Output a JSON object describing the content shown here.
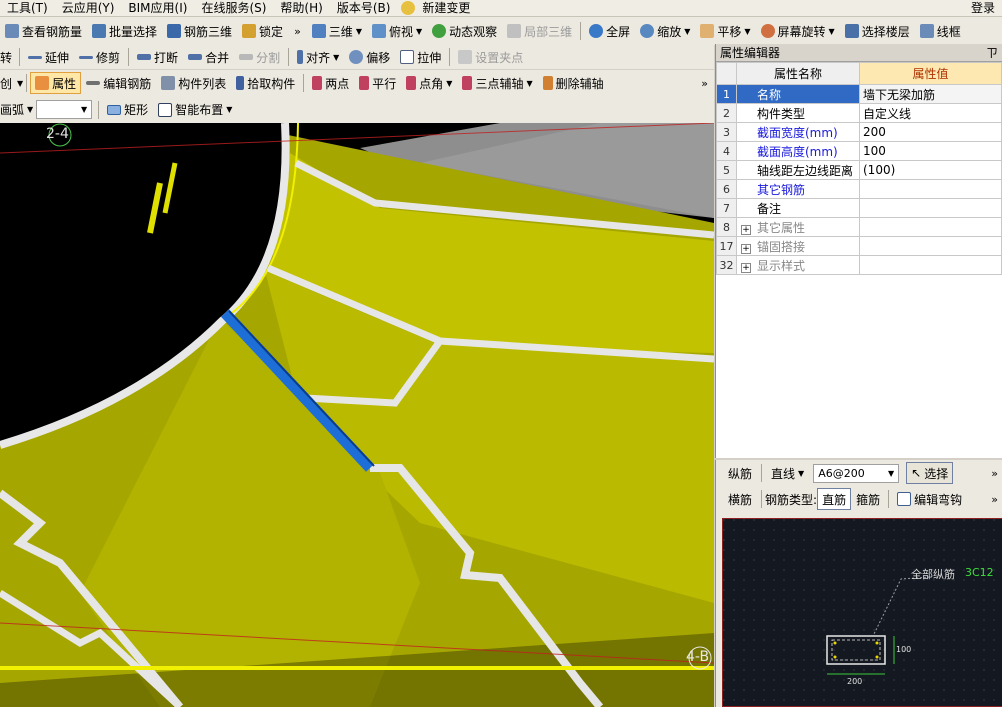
{
  "menu": [
    "工具(T)",
    "云应用(Y)",
    "BIM应用(I)",
    "在线服务(S)",
    "帮助(H)",
    "版本号(B)",
    "新建变更",
    "登录"
  ],
  "toolbar1": [
    "查看钢筋量",
    "批量选择",
    "钢筋三维",
    "锁定",
    "三维",
    "俯视",
    "动态观察",
    "局部三维",
    "全屏",
    "缩放",
    "平移",
    "屏幕旋转",
    "选择楼层",
    "线框"
  ],
  "toolbar2": [
    "转",
    "延伸",
    "修剪",
    "打断",
    "合并",
    "分割",
    "对齐",
    "偏移",
    "拉伸",
    "设置夹点"
  ],
  "toolbar3": [
    "创",
    "属性",
    "编辑钢筋",
    "构件列表",
    "拾取构件",
    "两点",
    "平行",
    "点角",
    "三点辅轴",
    "删除辅轴"
  ],
  "toolbar4": {
    "arc": "画弧",
    "rect": "矩形",
    "smart": "智能布置"
  },
  "viewport": {
    "axis_a": "2-4",
    "axis_b": "4-B"
  },
  "prop_panel": {
    "title": "属性编辑器",
    "pin": "ㄗ",
    "col_name": "属性名称",
    "col_value": "属性值",
    "rows": [
      {
        "num": "1",
        "name": "名称",
        "value": "墙下无梁加筋",
        "style": "sel"
      },
      {
        "num": "2",
        "name": "构件类型",
        "value": "自定义线",
        "style": ""
      },
      {
        "num": "3",
        "name": "截面宽度(mm)",
        "value": "200",
        "style": "blue"
      },
      {
        "num": "4",
        "name": "截面高度(mm)",
        "value": "100",
        "style": "blue"
      },
      {
        "num": "5",
        "name": "轴线距左边线距离",
        "value": "(100)",
        "style": ""
      },
      {
        "num": "6",
        "name": "其它钢筋",
        "value": "",
        "style": "blue"
      },
      {
        "num": "7",
        "name": "备注",
        "value": "",
        "style": ""
      },
      {
        "num": "8",
        "name": "其它属性",
        "value": "",
        "style": "gray",
        "expand": "+"
      },
      {
        "num": "17",
        "name": "锚固搭接",
        "value": "",
        "style": "gray",
        "expand": "+"
      },
      {
        "num": "32",
        "name": "显示样式",
        "value": "",
        "style": "gray",
        "expand": "+"
      }
    ]
  },
  "rebar": {
    "longitudinal": "纵筋",
    "shape": "直线",
    "spec": "A6@200",
    "select": "选择",
    "transverse": "横筋",
    "type_label": "钢筋类型:",
    "straight": "直筋",
    "stirrup": "箍筋",
    "edit_hook": "编辑弯钩",
    "cad_label": "全部纵筋",
    "cad_value": "3C12",
    "dim_h": "100",
    "dim_w": "200"
  },
  "colors": {
    "wall": "#c8c800",
    "selected": "#1e6ed8",
    "accent": "#316ac5"
  }
}
